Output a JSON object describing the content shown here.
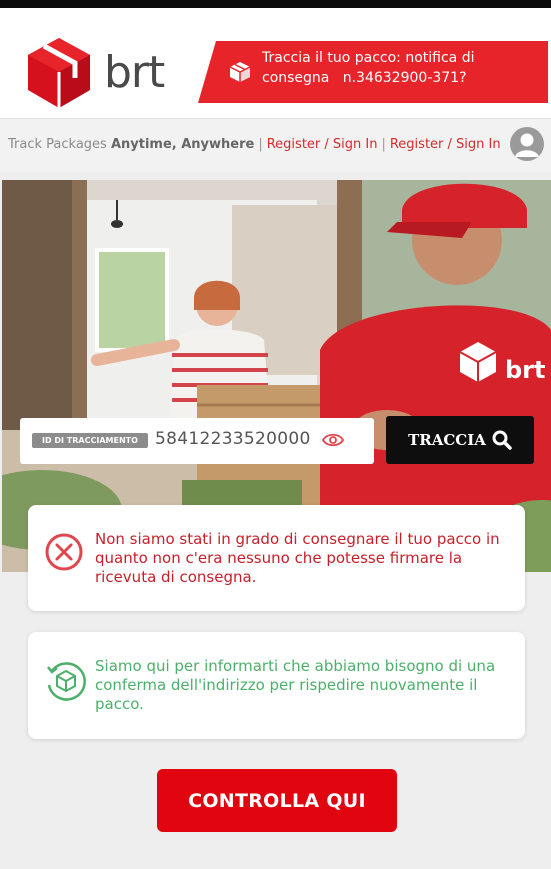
{
  "header": {
    "logo_text": "brt",
    "notice_text": "Traccia il tuo pacco: notifica di consegna   n.34632900-371?"
  },
  "subbar": {
    "tagline_prefix": "Track Packages",
    "tagline_bold": "Anytime, Anywhere",
    "link1": "Register / Sign In",
    "link2": "Register / Sign In"
  },
  "hero": {
    "track_label": "ID DI TRACCIAMENTO",
    "tracking_number": "58412233520000",
    "track_button": "TRACCIA",
    "uniform_logo": "brt"
  },
  "alerts": {
    "error_text": "Non siamo stati in grado di consegnare il tuo pacco in quanto non c'era nessuno che potesse firmare la ricevuta di consegna.",
    "info_text": "Siamo qui per informarti che abbiamo bisogno di una conferma dell'indirizzo per rispedire nuovamente il pacco."
  },
  "cta": {
    "label": "CONTROLLA QUI"
  },
  "colors": {
    "brand_red": "#e8242b",
    "error_red": "#c8202a",
    "info_green": "#4cb06a",
    "cta_red": "#e0050f"
  }
}
